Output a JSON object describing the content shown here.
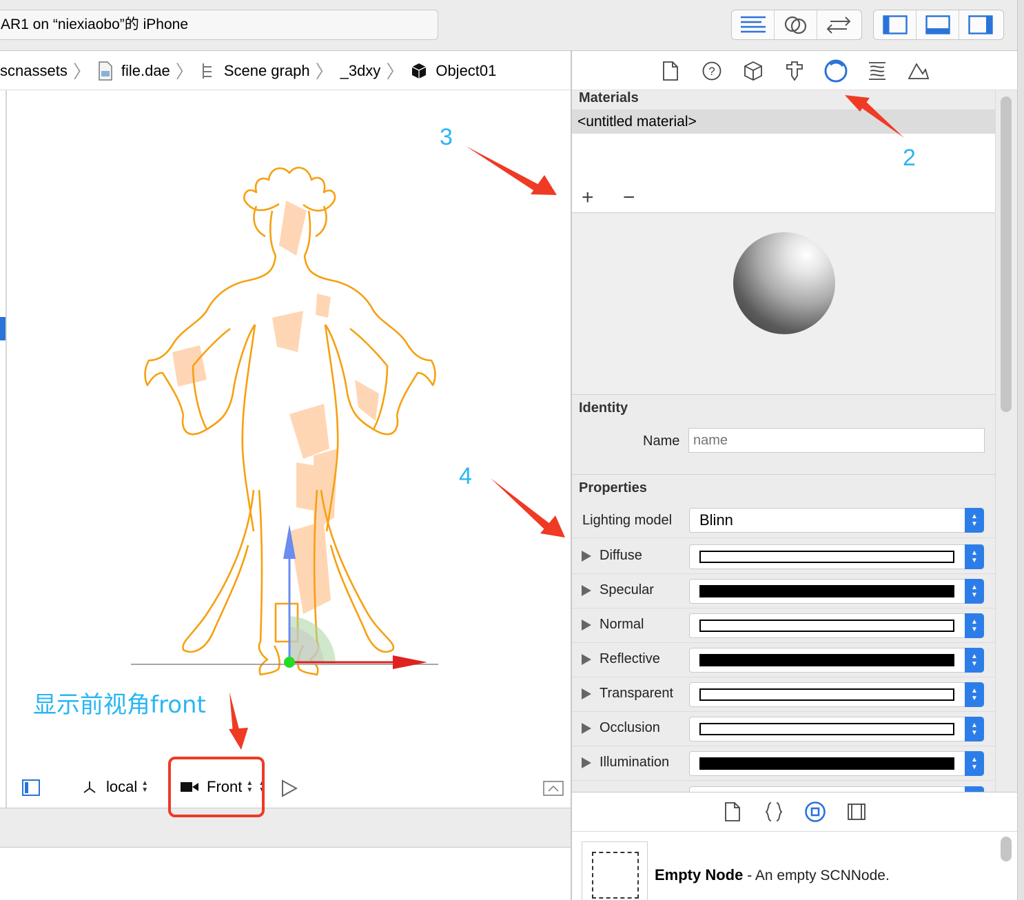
{
  "toolbar": {
    "activity_text": "AR1 on “niexiaobo”的 iPhone",
    "editor_buttons": [
      "standard-editor-icon",
      "assistant-editor-icon",
      "version-editor-icon"
    ],
    "view_buttons": [
      "navigator-toggle-icon",
      "debug-area-toggle-icon",
      "utilities-toggle-icon"
    ],
    "accent_color": "#2a73d9"
  },
  "jumpbar": {
    "crumbs": [
      {
        "label": "scnassets",
        "icon": "folder-icon"
      },
      {
        "label": "file.dae",
        "icon": "dae-file-icon"
      },
      {
        "label": "Scene graph",
        "icon": "scene-graph-icon"
      },
      {
        "label": "_3dxy",
        "icon": ""
      },
      {
        "label": "Object01",
        "icon": "cube-icon"
      }
    ]
  },
  "editor": {
    "coord_space": "local",
    "camera": "Front"
  },
  "inspector": {
    "tabs": [
      "file-inspector-icon",
      "quick-help-icon",
      "node-inspector-icon",
      "attributes-inspector-icon",
      "material-inspector-icon",
      "physics-inspector-icon",
      "scene-inspector-icon"
    ],
    "active_tab": "material-inspector-icon",
    "materials": {
      "title": "Materials",
      "items": [
        "<untitled material>"
      ],
      "add_label": "+",
      "remove_label": "−"
    },
    "identity": {
      "title": "Identity",
      "name_label": "Name",
      "name_placeholder": "name",
      "name_value": ""
    },
    "properties": {
      "title": "Properties",
      "lighting_label": "Lighting model",
      "lighting_value": "Blinn",
      "rows": [
        {
          "label": "Diffuse",
          "color": "#ffffff"
        },
        {
          "label": "Specular",
          "color": "#000000"
        },
        {
          "label": "Normal",
          "color": "#ffffff"
        },
        {
          "label": "Reflective",
          "color": "#000000"
        },
        {
          "label": "Transparent",
          "color": "#ffffff"
        },
        {
          "label": "Occlusion",
          "color": "#ffffff"
        },
        {
          "label": "Illumination",
          "color": "#000000"
        }
      ]
    }
  },
  "library": {
    "tabs": [
      "file-template-icon",
      "code-snippet-icon",
      "object-library-icon",
      "media-library-icon"
    ],
    "active_tab": "object-library-icon",
    "item_title": "Empty Node",
    "item_desc": " - An empty SCNNode."
  },
  "annotations": {
    "n2": "2",
    "n3": "3",
    "n4": "4",
    "caption": "显示前视角front",
    "arrow_color": "#ef3a24",
    "text_color": "#29b6f2"
  }
}
